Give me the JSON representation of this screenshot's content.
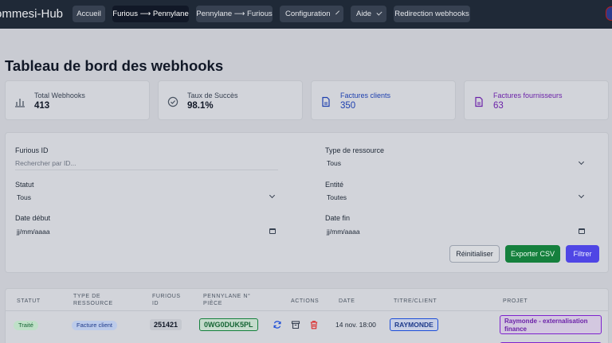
{
  "app": {
    "brand": "ommesi-Hub"
  },
  "nav": [
    {
      "label": "Accueil"
    },
    {
      "label": "Furious ⟶ Pennylane"
    },
    {
      "label": "Pennylane ⟶ Furious"
    },
    {
      "label": "Configuration"
    },
    {
      "label": "Aide"
    },
    {
      "label": "Redirection webhooks"
    }
  ],
  "page": {
    "title": "Tableau de bord des webhooks"
  },
  "stats": [
    {
      "label": "Total Webhooks",
      "value": "413",
      "icon": "bar-chart-icon"
    },
    {
      "label": "Taux de Succès",
      "value": "98.1%",
      "icon": "check-circle-icon"
    },
    {
      "label": "Factures clients",
      "value": "350",
      "icon": "document-icon"
    },
    {
      "label": "Factures fournisseurs",
      "value": "63",
      "icon": "document-icon"
    }
  ],
  "filters": {
    "furious_id": {
      "label": "Furious ID",
      "placeholder": "Rechercher par ID..."
    },
    "resource_type": {
      "label": "Type de ressource",
      "value": "Tous"
    },
    "status": {
      "label": "Statut",
      "value": "Tous"
    },
    "entity": {
      "label": "Entité",
      "value": "Toutes"
    },
    "date_start": {
      "label": "Date début",
      "placeholder": "jj/mm/aaaa"
    },
    "date_end": {
      "label": "Date fin",
      "placeholder": "jj/mm/aaaa"
    },
    "reset_label": "Réinitialiser",
    "export_label": "Exporter CSV",
    "filter_label": "Filtrer"
  },
  "table": {
    "columns": {
      "status": "STATUT",
      "type_1": "TYPE DE",
      "type_2": "RESSOURCE",
      "fid_1": "FURIOUS",
      "fid_2": "ID",
      "pno_1": "PENNYLANE N°",
      "pno_2": "PIÈCE",
      "actions": "ACTIONS",
      "date": "DATE",
      "client": "TITRE/CLIENT",
      "project": "PROJET"
    },
    "rows": [
      {
        "status": "Traité",
        "type": "Facture client",
        "furious_id": "251421",
        "pennylane_no": "0WG0DUK5PL",
        "date": "14 nov. 18:00",
        "client": "RAYMONDE",
        "project": "Raymonde - externalisation finance"
      }
    ]
  },
  "colors": {
    "nav_bg": "#1f2937",
    "success": "#15803d",
    "primary": "#4f46e5",
    "client_blue": "#1d4ed8",
    "project_purple": "#7e22ce"
  }
}
